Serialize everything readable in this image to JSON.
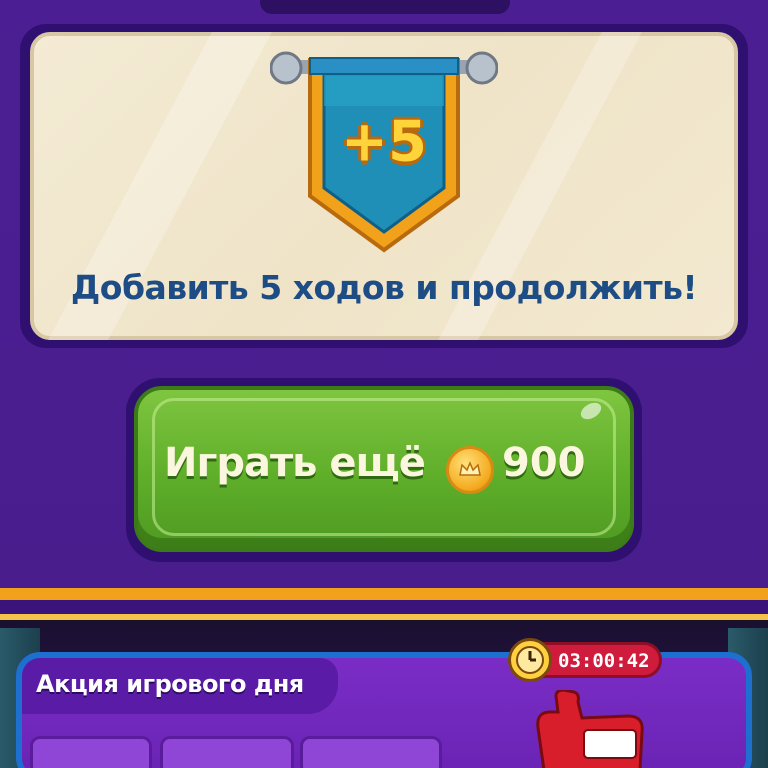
{
  "banner": {
    "text": "+5"
  },
  "subtitle": "Добавить 5 ходов и продолжить!",
  "play_button": {
    "label": "Играть ещё",
    "price": "900",
    "currency_icon": "coin-icon"
  },
  "promo": {
    "title": "Акция игрового дня",
    "timer": "03:00:42",
    "timer_icon": "clock-icon"
  },
  "colors": {
    "background": "#4a1e8c",
    "panel": "#f2e8cf",
    "subtitle": "#1e4d86",
    "button_green": "#5fae2a",
    "banner_blue": "#1f8fb8",
    "banner_gold": "#f2a21a",
    "timer_red": "#cf1c3c"
  }
}
